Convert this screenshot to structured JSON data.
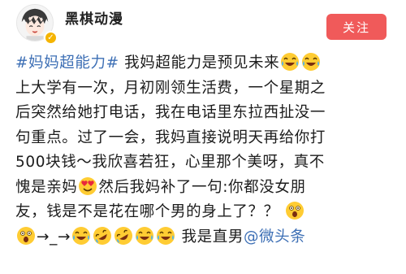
{
  "author": {
    "name": "黑棋动漫",
    "verified_icon": "verified-badge-icon"
  },
  "header": {
    "follow_label": "关注"
  },
  "post": {
    "hashtag": "#妈妈超能力#",
    "line1_text": " 我妈超能力是预见未来",
    "line2": "上大学有一次，月初刚领生活费，一个星期之",
    "line3": "后突然给她打电话，我在电话里东拉西扯没一",
    "line4": "句重点。过了一会，我妈直接说明天再给你打",
    "line5": "500块钱～我欣喜若狂，心里那个美呀，真不",
    "line6_text": "愧是亲妈",
    "line6_tail": "然后我妈补了一句:你都没女朋",
    "line7": "友，钱是不是花在哪个男的身上了？？",
    "line8_arrow": "→_→",
    "line8_text": "我是直男",
    "mention": "@微头条"
  },
  "emoji_names": {
    "laughing_tears": "laughing-tears-emoji",
    "heart_eyes": "heart-eyes-emoji",
    "shocked": "shocked-emoji",
    "rolling_laugh": "rolling-laugh-emoji"
  },
  "colors": {
    "link": "#3d6fb5",
    "follow_button": "#f05a5a",
    "verified": "#f5b400"
  }
}
